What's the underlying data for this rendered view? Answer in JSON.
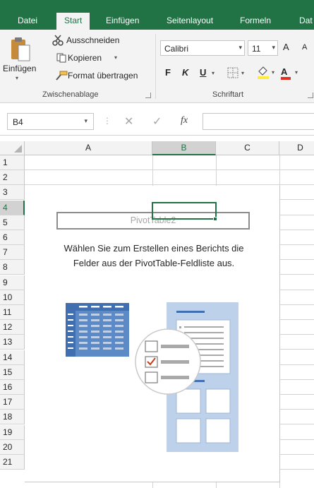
{
  "ribbon": {
    "tabs": [
      {
        "label": "Datei",
        "active": false
      },
      {
        "label": "Start",
        "active": true
      },
      {
        "label": "Einfügen",
        "active": false
      },
      {
        "label": "Seitenlayout",
        "active": false
      },
      {
        "label": "Formeln",
        "active": false
      },
      {
        "label": "Dat",
        "active": false
      }
    ],
    "clipboard": {
      "paste_label": "Einfügen",
      "cut_label": "Ausschneiden",
      "copy_label": "Kopieren",
      "format_painter_label": "Format übertragen",
      "group_label": "Zwischenablage"
    },
    "font": {
      "font_name": "Calibri",
      "font_size": "11",
      "bold_label": "F",
      "italic_label": "K",
      "underline_label": "U",
      "grow_label": "A",
      "shrink_label": "A",
      "font_color_label": "A",
      "group_label": "Schriftart"
    }
  },
  "formula_bar": {
    "name_box": "B4",
    "fx_label": "fx",
    "formula": ""
  },
  "grid": {
    "columns": [
      {
        "label": "A",
        "selected": false
      },
      {
        "label": "B",
        "selected": true
      },
      {
        "label": "C",
        "selected": false
      },
      {
        "label": "D",
        "selected": false
      }
    ],
    "rows": [
      "1",
      "2",
      "3",
      "4",
      "5",
      "6",
      "7",
      "8",
      "9",
      "10",
      "11",
      "12",
      "13",
      "14",
      "15",
      "16",
      "17",
      "18",
      "19",
      "20",
      "21"
    ],
    "selected_row": "4"
  },
  "pivot": {
    "name": "PivotTable2",
    "message_line1": "Wählen Sie zum Erstellen eines Berichts die",
    "message_line2": "Felder aus der PivotTable-Feldliste aus."
  },
  "colors": {
    "brand": "#217346",
    "selection": "#217346",
    "illustration_blue": "#5b8ac6",
    "illustration_light": "#bdd1ea",
    "check_red": "#c43e1c"
  }
}
